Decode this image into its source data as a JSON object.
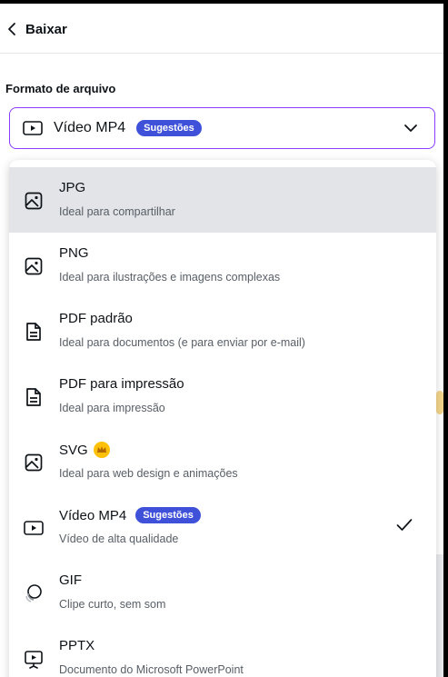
{
  "header": {
    "back_icon": "chevron-left-icon",
    "title": "Baixar"
  },
  "format": {
    "label": "Formato de arquivo",
    "selected_value": "Vídeo MP4",
    "selected_badge": "Sugestões"
  },
  "options": [
    {
      "name": "JPG",
      "desc": "Ideal para compartilhar",
      "icon": "image-icon"
    },
    {
      "name": "PNG",
      "desc": "Ideal para ilustrações e imagens complexas",
      "icon": "image-icon"
    },
    {
      "name": "PDF padrão",
      "desc": "Ideal para documentos (e para enviar por e-mail)",
      "icon": "document-icon"
    },
    {
      "name": "PDF para impressão",
      "desc": "Ideal para impressão",
      "icon": "document-icon"
    },
    {
      "name": "SVG",
      "desc": "Ideal para web design e animações",
      "icon": "image-icon",
      "premium": true
    },
    {
      "name": "Vídeo MP4",
      "desc": "Vídeo de alta qualidade",
      "icon": "video-icon",
      "badge": "Sugestões",
      "checked": true
    },
    {
      "name": "GIF",
      "desc": "Clipe curto, sem som",
      "icon": "gif-icon"
    },
    {
      "name": "PPTX",
      "desc": "Documento do Microsoft PowerPoint",
      "icon": "presentation-icon"
    }
  ],
  "colors": {
    "accent": "#8b3dff",
    "badge": "#3f51d9",
    "premium": "#ffc107",
    "hover": "#e2e4e7"
  }
}
